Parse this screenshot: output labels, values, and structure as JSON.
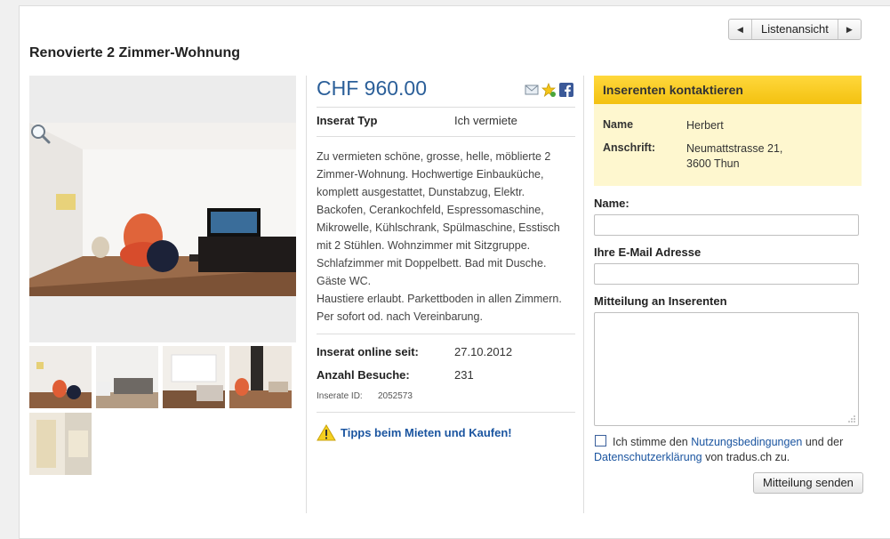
{
  "nav": {
    "list_view_label": "Listenansicht",
    "prev_icon": "triangle-left-icon",
    "next_icon": "triangle-right-icon"
  },
  "listing": {
    "title": "Renovierte 2 Zimmer-Wohnung",
    "price": "CHF 960.00",
    "type_label": "Inserat Typ",
    "type_value": "Ich vermiete",
    "description": [
      "Zu vermieten schöne, grosse, helle, möblierte 2",
      "Zimmer-Wohnung. Hochwertige Einbauküche,",
      "komplett ausgestattet, Dunstabzug, Elektr.",
      "Backofen, Cerankochfeld, Espressomaschine,",
      "Mikrowelle, Kühlschrank, Spülmaschine, Esstisch",
      "mit 2 Stühlen. Wohnzimmer mit Sitzgruppe.",
      "Schlafzimmer mit Doppelbett. Bad mit Dusche.",
      "Gäste WC.",
      "Haustiere erlaubt. Parkettboden in allen Zimmern.",
      "Per sofort od. nach Vereinbarung."
    ],
    "online_label": "Inserat online seit:",
    "online_value": "27.10.2012",
    "visits_label": "Anzahl Besuche:",
    "visits_value": "231",
    "id_label": "Inserate ID:",
    "id_value": "2052573",
    "tips_link": "Tipps beim Mieten und Kaufen!"
  },
  "contact": {
    "header": "Inserenten kontaktieren",
    "name_key": "Name",
    "name_value": "Herbert",
    "address_key": "Anschrift:",
    "address_line1": "Neumattstrasse 21,",
    "address_line2": "3600 Thun",
    "form_name_label": "Name:",
    "form_email_label": "Ihre E-Mail Adresse",
    "form_message_label": "Mitteilung an Inserenten",
    "agree_prefix": "Ich stimme den",
    "agree_terms_link": "Nutzungsbedingungen",
    "agree_and": "und der",
    "agree_privacy_link": "Datenschutzerklärung",
    "agree_suffix": "von tradus.ch zu.",
    "send_label": "Mitteilung senden"
  },
  "colors": {
    "price": "#2b5f99",
    "header_yellow": "#f3c110",
    "contact_bg": "#fef7cf",
    "link": "#1b55a0"
  }
}
